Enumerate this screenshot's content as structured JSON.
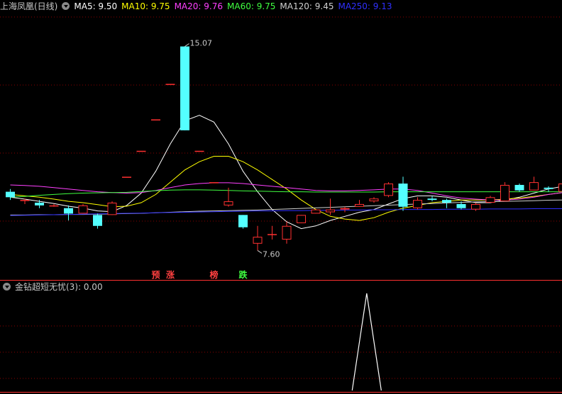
{
  "title": "上海凤凰(日线)",
  "ma_legend": [
    {
      "label": "MA5: 9.50",
      "color": "#ffffff"
    },
    {
      "label": "MA10: 9.75",
      "color": "#ffff00"
    },
    {
      "label": "MA20: 9.76",
      "color": "#ff40ff"
    },
    {
      "label": "MA60: 9.75",
      "color": "#40ff40"
    },
    {
      "label": "MA120: 9.45",
      "color": "#d0d0d0"
    },
    {
      "label": "MA250: 9.13",
      "color": "#3030ff"
    }
  ],
  "indicator": {
    "name": "金钻超短无忧(3)",
    "value_text": ": 0.00"
  },
  "annotations": {
    "high": "15.07",
    "low": "7.60",
    "signals": [
      {
        "text": "预",
        "color": "#ff4040",
        "bar": 10
      },
      {
        "text": "涨",
        "color": "#ff4040",
        "bar": 11
      },
      {
        "text": "榜",
        "color": "#ff4040",
        "bar": 14
      },
      {
        "text": "跌",
        "color": "#40ff40",
        "bar": 16
      }
    ]
  },
  "colors": {
    "up": "#ff3030",
    "down": "#54ffff",
    "grid": "#8b0000",
    "separator": "#ff3030"
  },
  "chart_data": {
    "type": "candlestick",
    "ylim": [
      6.6,
      16.2
    ],
    "candles": [
      {
        "o": 9.75,
        "h": 9.85,
        "l": 9.45,
        "c": 9.55
      },
      {
        "o": 9.45,
        "h": 9.5,
        "l": 9.3,
        "c": 9.45
      },
      {
        "o": 9.35,
        "h": 9.45,
        "l": 9.15,
        "c": 9.25
      },
      {
        "o": 9.25,
        "h": 9.3,
        "l": 9.2,
        "c": 9.25
      },
      {
        "o": 9.15,
        "h": 9.25,
        "l": 8.7,
        "c": 8.95
      },
      {
        "o": 8.95,
        "h": 9.3,
        "l": 8.95,
        "c": 9.25
      },
      {
        "o": 8.9,
        "h": 8.95,
        "l": 8.4,
        "c": 8.5
      },
      {
        "o": 8.9,
        "h": 9.4,
        "l": 8.9,
        "c": 9.35
      },
      {
        "o": 10.3,
        "h": 10.3,
        "l": 10.3,
        "c": 10.3
      },
      {
        "o": 11.25,
        "h": 11.25,
        "l": 11.25,
        "c": 11.25
      },
      {
        "o": 12.4,
        "h": 12.4,
        "l": 12.4,
        "c": 12.4
      },
      {
        "o": 13.7,
        "h": 13.7,
        "l": 13.7,
        "c": 13.7
      },
      {
        "o": 15.07,
        "h": 15.07,
        "l": 12.0,
        "c": 12.0
      },
      {
        "o": 11.25,
        "h": 11.25,
        "l": 11.25,
        "c": 11.25
      },
      {
        "o": 10.1,
        "h": 10.1,
        "l": 10.1,
        "c": 10.1
      },
      {
        "o": 9.25,
        "h": 9.9,
        "l": 9.2,
        "c": 9.4
      },
      {
        "o": 8.9,
        "h": 8.9,
        "l": 8.4,
        "c": 8.45
      },
      {
        "o": 7.85,
        "h": 8.5,
        "l": 7.6,
        "c": 8.1
      },
      {
        "o": 8.2,
        "h": 8.5,
        "l": 8.0,
        "c": 8.2
      },
      {
        "o": 8.0,
        "h": 8.65,
        "l": 7.85,
        "c": 8.5
      },
      {
        "o": 8.6,
        "h": 8.9,
        "l": 8.6,
        "c": 8.9
      },
      {
        "o": 8.95,
        "h": 9.1,
        "l": 8.95,
        "c": 9.1
      },
      {
        "o": 9.0,
        "h": 9.5,
        "l": 8.9,
        "c": 9.1
      },
      {
        "o": 9.1,
        "h": 9.2,
        "l": 9.0,
        "c": 9.15
      },
      {
        "o": 9.2,
        "h": 9.45,
        "l": 9.2,
        "c": 9.3
      },
      {
        "o": 9.4,
        "h": 9.55,
        "l": 9.35,
        "c": 9.5
      },
      {
        "o": 9.6,
        "h": 10.1,
        "l": 9.55,
        "c": 10.05
      },
      {
        "o": 10.05,
        "h": 10.3,
        "l": 9.05,
        "c": 9.2
      },
      {
        "o": 9.15,
        "h": 9.55,
        "l": 9.1,
        "c": 9.45
      },
      {
        "o": 9.5,
        "h": 9.6,
        "l": 9.4,
        "c": 9.45
      },
      {
        "o": 9.45,
        "h": 9.5,
        "l": 9.15,
        "c": 9.35
      },
      {
        "o": 9.3,
        "h": 9.4,
        "l": 9.1,
        "c": 9.15
      },
      {
        "o": 9.1,
        "h": 9.35,
        "l": 9.05,
        "c": 9.3
      },
      {
        "o": 9.35,
        "h": 9.6,
        "l": 9.35,
        "c": 9.55
      },
      {
        "o": 9.4,
        "h": 10.1,
        "l": 9.4,
        "c": 10.0
      },
      {
        "o": 10.0,
        "h": 10.05,
        "l": 9.75,
        "c": 9.8
      },
      {
        "o": 9.8,
        "h": 10.3,
        "l": 9.8,
        "c": 10.1
      },
      {
        "o": 9.9,
        "h": 9.95,
        "l": 9.75,
        "c": 9.85
      },
      {
        "o": 9.75,
        "h": 10.1,
        "l": 9.75,
        "c": 10.05
      }
    ],
    "ma": [
      {
        "name": "MA5",
        "color": "#ffffff",
        "values": [
          9.55,
          9.48,
          9.4,
          9.32,
          9.22,
          9.15,
          9.05,
          9.02,
          9.25,
          9.7,
          10.5,
          11.5,
          12.35,
          12.55,
          12.3,
          11.5,
          10.5,
          9.75,
          9.1,
          8.65,
          8.4,
          8.5,
          8.7,
          8.85,
          9.0,
          9.1,
          9.3,
          9.5,
          9.6,
          9.6,
          9.55,
          9.45,
          9.35,
          9.35,
          9.45,
          9.55,
          9.7,
          9.85,
          9.95
        ]
      },
      {
        "name": "MA10",
        "color": "#ffff00",
        "values": [
          9.65,
          9.6,
          9.55,
          9.48,
          9.4,
          9.35,
          9.28,
          9.2,
          9.22,
          9.35,
          9.65,
          10.1,
          10.55,
          10.85,
          11.05,
          11.05,
          10.85,
          10.55,
          10.2,
          9.85,
          9.45,
          9.1,
          8.85,
          8.75,
          8.7,
          8.8,
          9.0,
          9.15,
          9.25,
          9.35,
          9.4,
          9.45,
          9.45,
          9.45,
          9.48,
          9.52,
          9.58,
          9.65,
          9.72
        ]
      },
      {
        "name": "MA20",
        "color": "#ff40ff",
        "values": [
          10.0,
          9.98,
          9.95,
          9.9,
          9.85,
          9.8,
          9.75,
          9.72,
          9.7,
          9.72,
          9.8,
          9.9,
          10.0,
          10.05,
          10.08,
          10.08,
          10.05,
          10.0,
          9.95,
          9.9,
          9.85,
          9.8,
          9.78,
          9.78,
          9.8,
          9.82,
          9.85,
          9.85,
          9.8,
          9.7,
          9.6,
          9.52,
          9.48,
          9.45,
          9.45,
          9.48,
          9.55,
          9.65,
          9.72
        ]
      },
      {
        "name": "MA60",
        "color": "#40ff40",
        "values": [
          9.55,
          9.58,
          9.62,
          9.65,
          9.68,
          9.7,
          9.71,
          9.72,
          9.73,
          9.76,
          9.79,
          9.81,
          9.82,
          9.82,
          9.81,
          9.8,
          9.78,
          9.77,
          9.76,
          9.75,
          9.75,
          9.74,
          9.74,
          9.74,
          9.74,
          9.74,
          9.75,
          9.75,
          9.75,
          9.75,
          9.75,
          9.75,
          9.75,
          9.75,
          9.75,
          9.75,
          9.75,
          9.75,
          9.75
        ]
      },
      {
        "name": "MA120",
        "color": "#d0d0d0",
        "values": [
          8.9,
          8.9,
          8.91,
          8.91,
          8.92,
          8.92,
          8.93,
          8.94,
          8.95,
          8.96,
          8.98,
          9.0,
          9.02,
          9.04,
          9.05,
          9.06,
          9.07,
          9.08,
          9.1,
          9.12,
          9.14,
          9.16,
          9.18,
          9.2,
          9.22,
          9.24,
          9.26,
          9.28,
          9.3,
          9.32,
          9.34,
          9.36,
          9.38,
          9.39,
          9.4,
          9.41,
          9.42,
          9.44,
          9.45
        ]
      },
      {
        "name": "MA250",
        "color": "#3030ff",
        "values": [
          8.88,
          8.89,
          8.9,
          8.91,
          8.92,
          8.93,
          8.94,
          8.95,
          8.96,
          8.97,
          8.98,
          8.99,
          9.0,
          9.01,
          9.02,
          9.03,
          9.04,
          9.05,
          9.05,
          9.06,
          9.06,
          9.07,
          9.07,
          9.08,
          9.08,
          9.09,
          9.09,
          9.1,
          9.1,
          9.1,
          9.11,
          9.11,
          9.11,
          9.12,
          9.12,
          9.12,
          9.13,
          9.13,
          9.13
        ]
      }
    ],
    "indicator": {
      "name": "金钻超短无忧(3)",
      "ylim": [
        0,
        1.0
      ],
      "series": [
        {
          "x": 23.5,
          "y": 0
        },
        {
          "x": 24.5,
          "y": 1.0
        },
        {
          "x": 25.5,
          "y": 0
        }
      ]
    }
  }
}
